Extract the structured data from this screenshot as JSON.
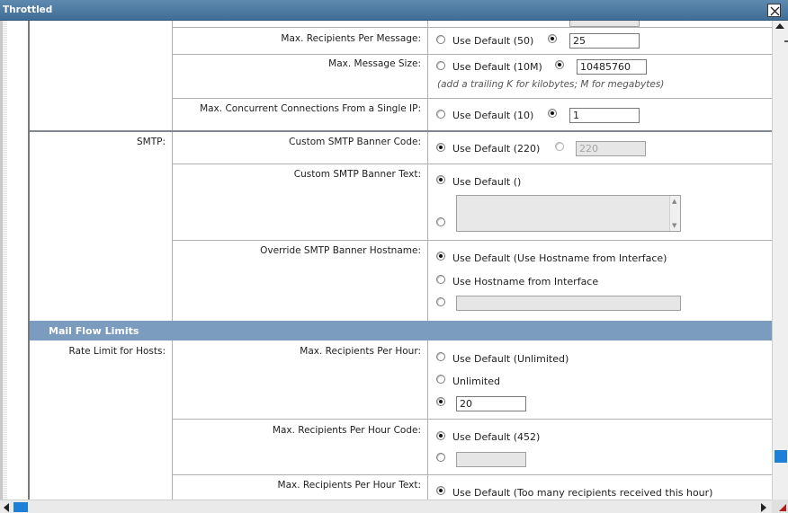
{
  "window": {
    "title": "Throttled"
  },
  "rows": {
    "max_recipients_per_message": {
      "label": "Max. Recipients Per Message:",
      "default_option": "Use Default (50)",
      "custom_value": "25"
    },
    "max_message_size": {
      "label": "Max. Message Size:",
      "default_option": "Use Default (10M)",
      "custom_value": "10485760",
      "hint": "(add a trailing K for kilobytes; M for megabytes)"
    },
    "max_concurrent_connections": {
      "label": "Max. Concurrent Connections From a Single IP:",
      "default_option": "Use Default (10)",
      "custom_value": "1"
    },
    "smtp": {
      "group_label": "SMTP:",
      "banner_code_label": "Custom SMTP Banner Code:",
      "banner_code_default": "Use Default (220)",
      "banner_code_value": "220",
      "banner_text_label": "Custom SMTP Banner Text:",
      "banner_text_default": "Use Default ()",
      "hostname_label": "Override SMTP Banner Hostname:",
      "hostname_default": "Use Default (Use Hostname from Interface)",
      "hostname_interface": "Use Hostname from Interface"
    }
  },
  "mail_flow": {
    "section_title": "Mail Flow Limits",
    "rate_limit_label": "Rate Limit for Hosts:",
    "per_hour_label": "Max. Recipients Per Hour:",
    "per_hour_default": "Use Default (Unlimited)",
    "per_hour_unlimited": "Unlimited",
    "per_hour_value": "20",
    "per_hour_code_label": "Max. Recipients Per Hour Code:",
    "per_hour_code_default": "Use Default (452)",
    "per_hour_text_label": "Max. Recipients Per Hour Text:",
    "per_hour_text_default": "Use Default (Too many recipients received this hour)"
  },
  "colors": {
    "titlebar": "#4a78a0",
    "section_header": "#7b9cbe",
    "scroll_thumb": "#1e7fd8"
  }
}
